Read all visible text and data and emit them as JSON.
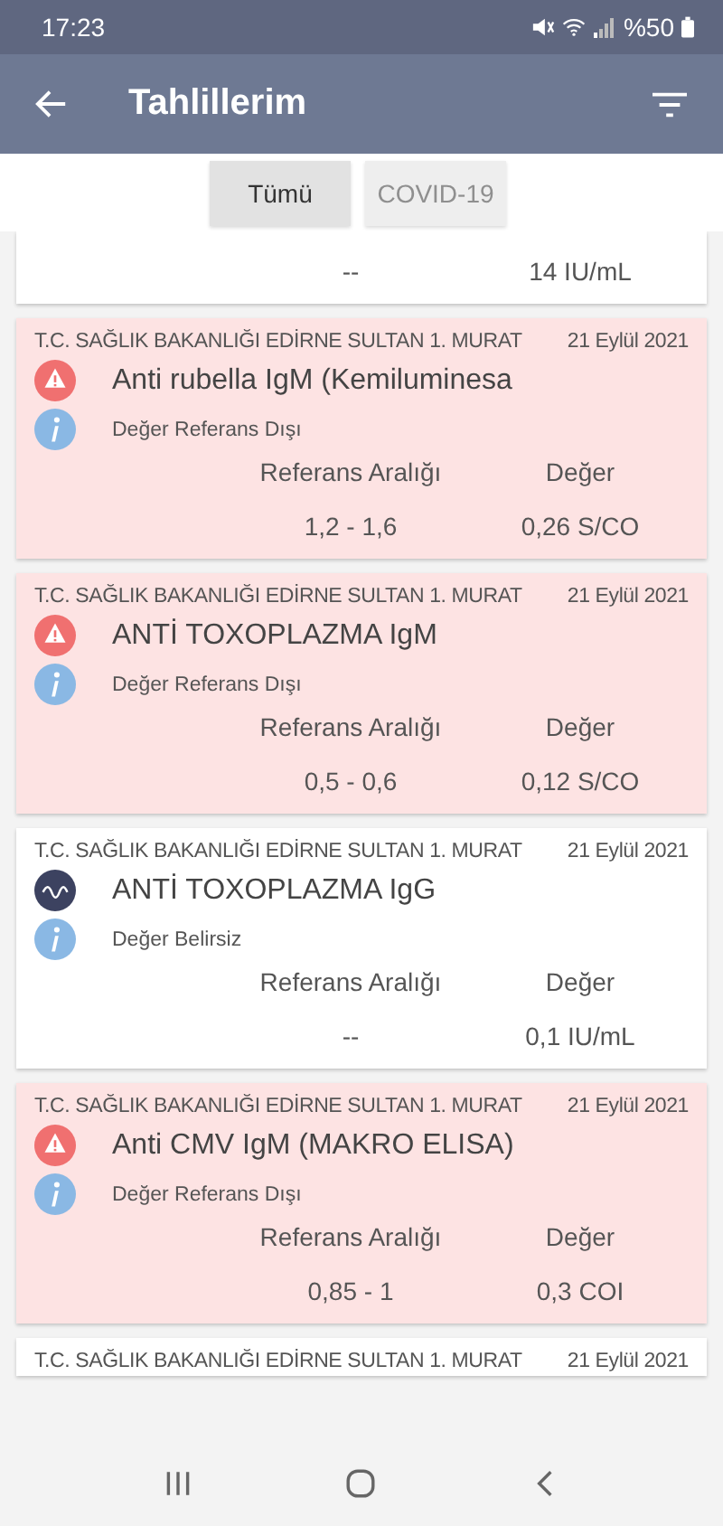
{
  "status_bar": {
    "time": "17:23",
    "battery_text": "%50"
  },
  "app_bar": {
    "title": "Tahlillerim"
  },
  "tabs": [
    {
      "label": "Tümü",
      "selected": true
    },
    {
      "label": "COVID-19",
      "selected": false
    }
  ],
  "partial_result": {
    "reference": "--",
    "value": "14 IU/mL"
  },
  "results": [
    {
      "kind": "alert",
      "institution": "T.C. SAĞLIK BAKANLIĞI EDİRNE SULTAN 1. MURAT",
      "date": "21 Eylül 2021",
      "name": "Anti rubella IgM (Kemiluminesa",
      "status": "Değer Referans Dışı",
      "reference_label": "Referans Aralığı",
      "value_label": "Değer",
      "reference": "1,2 - 1,6",
      "value": "0,26 S/CO"
    },
    {
      "kind": "alert",
      "institution": "T.C. SAĞLIK BAKANLIĞI EDİRNE SULTAN 1. MURAT",
      "date": "21 Eylül 2021",
      "name": "ANTİ TOXOPLAZMA IgM",
      "status": "Değer Referans Dışı",
      "reference_label": "Referans Aralığı",
      "value_label": "Değer",
      "reference": "0,5 - 0,6",
      "value": "0,12 S/CO"
    },
    {
      "kind": "uncertain",
      "institution": "T.C. SAĞLIK BAKANLIĞI EDİRNE SULTAN 1. MURAT",
      "date": "21 Eylül 2021",
      "name": "ANTİ TOXOPLAZMA IgG",
      "status": "Değer Belirsiz",
      "reference_label": "Referans Aralığı",
      "value_label": "Değer",
      "reference": "--",
      "value": "0,1 IU/mL"
    },
    {
      "kind": "alert",
      "institution": "T.C. SAĞLIK BAKANLIĞI EDİRNE SULTAN 1. MURAT",
      "date": "21 Eylül 2021",
      "name": "Anti CMV IgM (MAKRO ELISA)",
      "status": "Değer Referans Dışı",
      "reference_label": "Referans Aralığı",
      "value_label": "Değer",
      "reference": "0,85 - 1",
      "value": "0,3 COI"
    },
    {
      "kind": "partial",
      "institution": "T.C. SAĞLIK BAKANLIĞI EDİRNE SULTAN 1. MURAT",
      "date": "21 Eylül 2021"
    }
  ]
}
